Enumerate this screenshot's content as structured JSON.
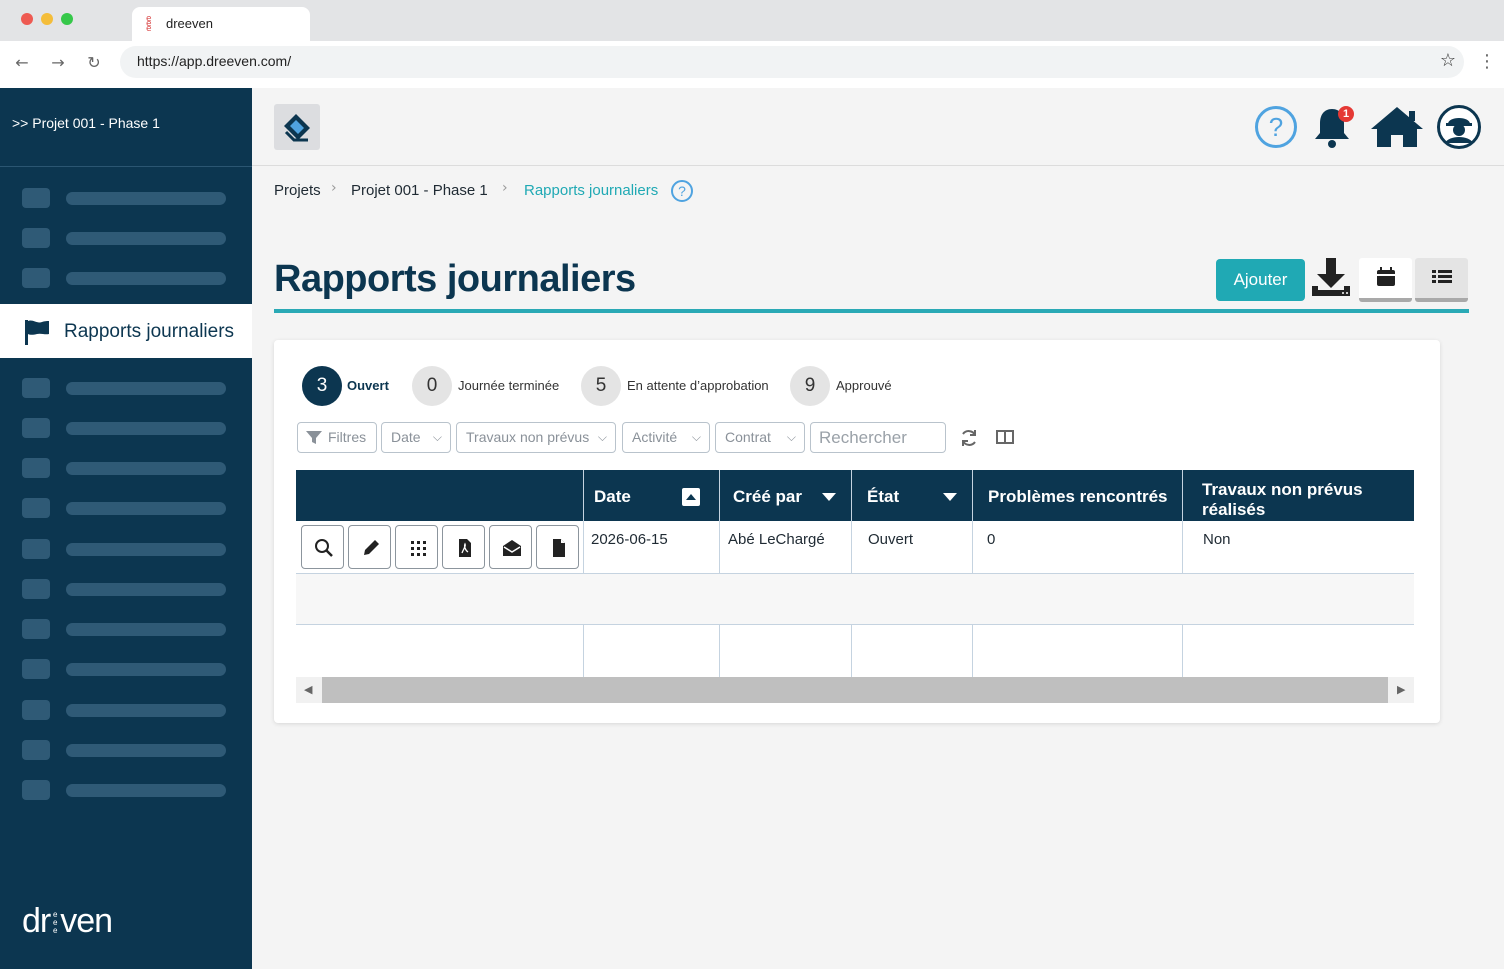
{
  "browser": {
    "tab_title": "dreeven",
    "url": "https://app.dreeven.com/"
  },
  "sidebar": {
    "project": ">> Projet 001 - Phase 1",
    "active_item": "Rapports journaliers",
    "logo": "dreeven"
  },
  "header": {
    "notification_count": "1"
  },
  "breadcrumb": {
    "items": [
      "Projets",
      "Projet 001 - Phase 1",
      "Rapports journaliers"
    ],
    "help": "?"
  },
  "page": {
    "title": "Rapports journaliers",
    "add_button": "Ajouter"
  },
  "statuses": [
    {
      "count": "3",
      "label": "Ouvert",
      "active": true
    },
    {
      "count": "0",
      "label": "Journée terminée",
      "active": false
    },
    {
      "count": "5",
      "label": "En attente d’approbation",
      "active": false
    },
    {
      "count": "9",
      "label": "Approuvé",
      "active": false
    }
  ],
  "filters": {
    "filtres": "Filtres",
    "date": "Date",
    "travaux": "Travaux non prévus",
    "activite": "Activité",
    "contrat": "Contrat",
    "search_placeholder": "Rechercher"
  },
  "table": {
    "columns": [
      "Date",
      "Créé par",
      "État",
      "Problèmes rencontrés",
      "Travaux non prévus réalisés"
    ],
    "rows": [
      [
        "2026-06-15",
        "Abé LeChargé",
        "Ouvert",
        "0",
        "Non"
      ]
    ]
  },
  "colors": {
    "navy": "#0c3650",
    "teal": "#20a9b4",
    "help_blue": "#4fa3e0",
    "badge_red": "#e53935"
  }
}
